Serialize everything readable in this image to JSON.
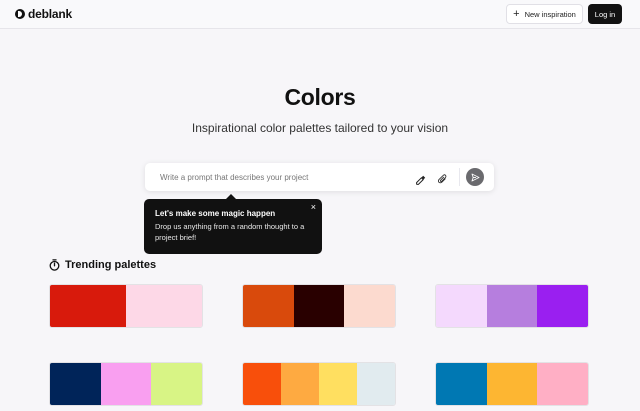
{
  "header": {
    "logo_text": "deblank",
    "new_button_label": "New inspiration",
    "login_button_label": "Log in"
  },
  "hero": {
    "title": "Colors",
    "subtitle": "Inspirational color palettes tailored to your vision"
  },
  "prompt": {
    "placeholder": "Write a prompt that describes your project",
    "value": ""
  },
  "tooltip": {
    "title": "Let's make some magic happen",
    "body": "Drop us anything from a random thought to a project brief!",
    "close_glyph": "×"
  },
  "trending": {
    "title": "Trending palettes",
    "palettes": [
      {
        "colors": [
          "#d81a0c",
          "#fdd8e7"
        ],
        "weights": [
          1,
          1
        ]
      },
      {
        "colors": [
          "#d94a0c",
          "#290000",
          "#fcdacf"
        ],
        "weights": [
          1,
          1,
          1
        ]
      },
      {
        "colors": [
          "#f4d9fd",
          "#b67ede",
          "#9a1ff0"
        ],
        "weights": [
          1,
          1,
          1
        ]
      },
      {
        "colors": [
          "#002459",
          "#f99ff0",
          "#d8f485"
        ],
        "weights": [
          1,
          1,
          1
        ]
      },
      {
        "colors": [
          "#f84f0b",
          "#feaa41",
          "#ffdf60",
          "#e1ebef"
        ],
        "weights": [
          1,
          1,
          1,
          1
        ]
      },
      {
        "colors": [
          "#0078b3",
          "#fdb632",
          "#ffafc5"
        ],
        "weights": [
          1,
          1,
          1
        ]
      }
    ]
  }
}
